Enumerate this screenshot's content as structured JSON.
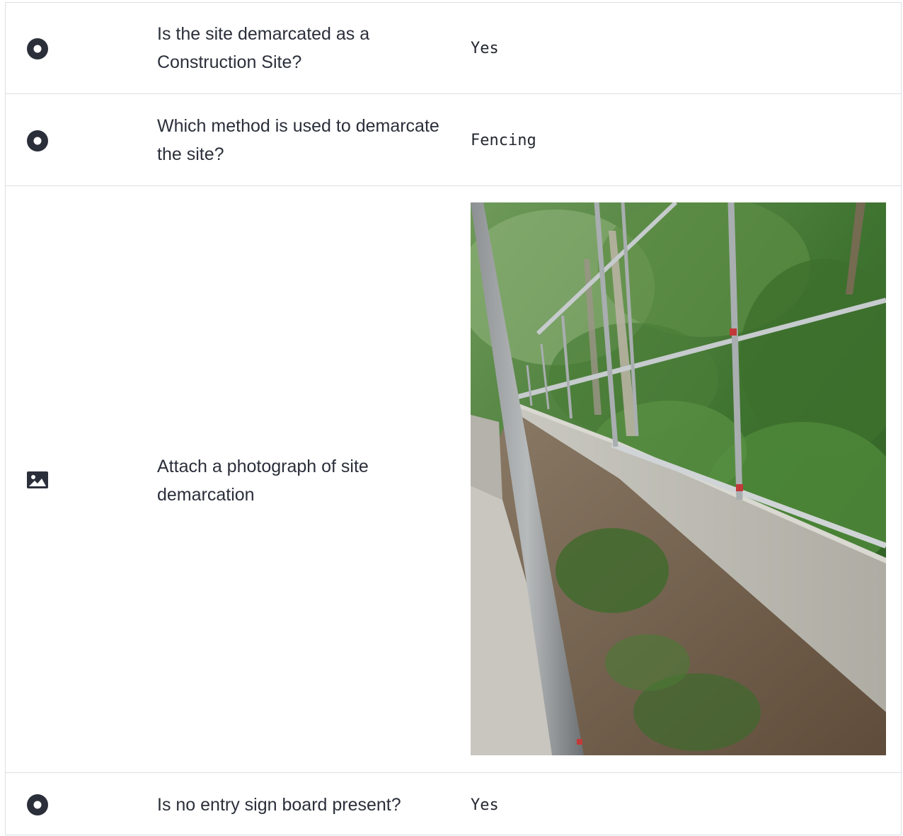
{
  "rows": [
    {
      "icon": "radio-icon",
      "question": "Is the site demarcated as a Construction Site?",
      "answer": "Yes"
    },
    {
      "icon": "radio-icon",
      "question": "Which method is used to demarcate the site?",
      "answer": "Fencing"
    },
    {
      "icon": "image-icon",
      "question": "Attach a photograph of site demarcation",
      "answer_type": "photo"
    },
    {
      "icon": "radio-icon",
      "question": "Is no entry sign board present?",
      "answer": "Yes"
    }
  ]
}
